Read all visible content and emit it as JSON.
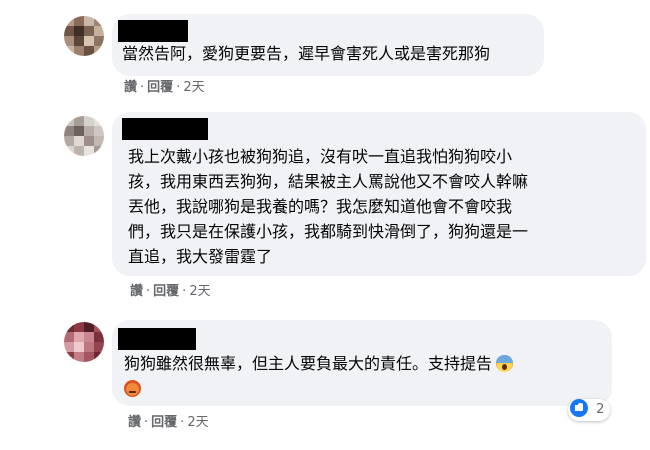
{
  "colors": {
    "bubble_bg": "#f0f2f5",
    "meta_text": "#65676b",
    "like_blue": "#1877f2"
  },
  "comments": [
    {
      "text": "當然告阿，愛狗更要告，遲早會害死人或是害死那狗",
      "actions": {
        "like": "讚",
        "reply": "回覆",
        "time": "2天"
      }
    },
    {
      "text": "我上次戴小孩也被狗狗追，沒有吠一直追我怕狗狗咬小\n孩，我用東西丟狗狗，結果被主人罵說他又不會咬人幹嘛\n丟他，我說哪狗是我養的嗎？我怎麼知道他會不會咬我\n們，我只是在保護小孩，我都騎到快滑倒了，狗狗還是一\n直追，我大發雷霆了",
      "actions": {
        "like": "讚",
        "reply": "回覆",
        "time": "2天"
      }
    },
    {
      "text": "狗狗雖然很無辜，但主人要負最大的責任。支持提告",
      "emojis": [
        "face-screaming-in-fear-icon",
        "angry-face-icon"
      ],
      "actions": {
        "like": "讚",
        "reply": "回覆",
        "time": "2天"
      },
      "reactions": {
        "icon": "like-icon",
        "count": "2"
      }
    }
  ]
}
